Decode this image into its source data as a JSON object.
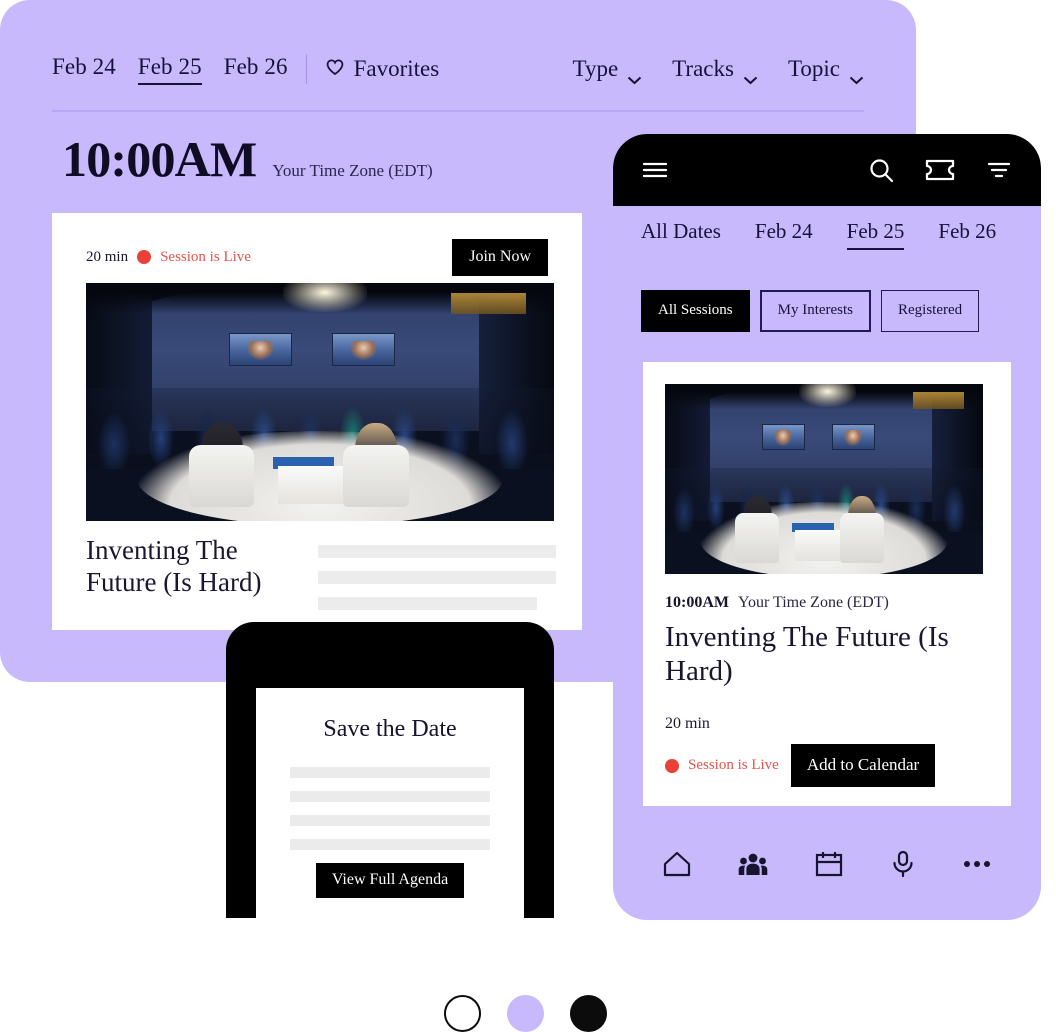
{
  "desktop": {
    "dates": [
      {
        "label": "Feb 24",
        "active": false
      },
      {
        "label": "Feb 25",
        "active": true
      },
      {
        "label": "Feb 26",
        "active": false
      }
    ],
    "favorites_label": "Favorites",
    "favorites_icon": "heart-icon",
    "filters": [
      {
        "label": "Type",
        "icon": "chevron-down-icon"
      },
      {
        "label": "Tracks",
        "icon": "chevron-down-icon"
      },
      {
        "label": "Topic",
        "icon": "chevron-down-icon"
      }
    ],
    "time": "10:00AM",
    "timezone": "Your Time Zone (EDT)",
    "card": {
      "duration": "20 min",
      "live_label": "Session is Live",
      "live_icon": "live-dot-icon",
      "join_label": "Join Now",
      "title": "Inventing The Future (Is Hard)",
      "image_alt": "conference-panel-photo"
    }
  },
  "mini_phone": {
    "title": "Save the Date",
    "button_label": "View Full Agenda"
  },
  "phone": {
    "topbar_icons": [
      {
        "name": "hamburger-menu-icon"
      },
      {
        "name": "search-icon"
      },
      {
        "name": "ticket-icon"
      },
      {
        "name": "filter-icon"
      }
    ],
    "dates": [
      {
        "label": "All Dates",
        "active": false
      },
      {
        "label": "Feb 24",
        "active": false
      },
      {
        "label": "Feb 25",
        "active": true
      },
      {
        "label": "Feb 26",
        "active": false
      }
    ],
    "pills": [
      {
        "label": "All Sessions",
        "style": "active"
      },
      {
        "label": "My Interests",
        "style": "medium"
      },
      {
        "label": "Registered",
        "style": "thin"
      }
    ],
    "card": {
      "image_alt": "conference-panel-photo",
      "time": "10:00AM",
      "timezone": "Your Time Zone (EDT)",
      "title": "Inventing The Future (Is Hard)",
      "duration": "20 min",
      "live_label": "Session is Live",
      "live_icon": "live-dot-icon",
      "calendar_label": "Add to Calendar"
    },
    "nav_icons": [
      {
        "name": "home-icon"
      },
      {
        "name": "people-icon"
      },
      {
        "name": "calendar-icon"
      },
      {
        "name": "microphone-icon"
      },
      {
        "name": "more-icon"
      }
    ]
  },
  "swatches": [
    {
      "name": "white",
      "color": "#ffffff"
    },
    {
      "name": "lavender",
      "color": "#c7b9fc"
    },
    {
      "name": "black",
      "color": "#0c0c0c"
    }
  ],
  "colors": {
    "lavender": "#c7b9fc",
    "black": "#000000",
    "live_red": "#e8534b",
    "ink": "#17123a"
  }
}
